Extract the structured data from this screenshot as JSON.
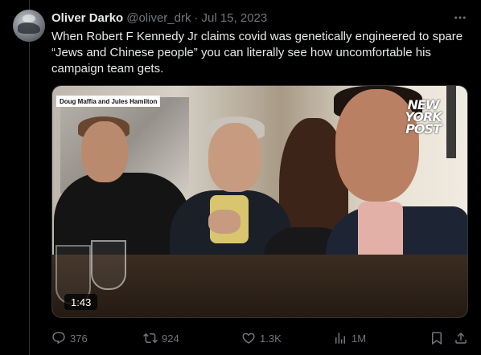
{
  "author": {
    "name": "Oliver Darko",
    "handle": "@oliver_drk",
    "separator": "·",
    "date": "Jul 15, 2023"
  },
  "tweet_text": "When Robert F Kennedy Jr claims covid was genetically engineered to spare “Jews and Chinese people” you can literally see how uncomfortable his campaign team gets.",
  "media": {
    "caption": "Doug Maffia and Jules Hamilton",
    "watermark_lines": [
      "NEW",
      "YORK",
      "POST"
    ],
    "duration": "1:43"
  },
  "actions": {
    "replies": "376",
    "reposts": "924",
    "likes": "1.3K",
    "views": "1M"
  },
  "icons": [
    "more-icon",
    "reply-icon",
    "repost-icon",
    "like-icon",
    "views-icon",
    "bookmark-icon",
    "share-icon"
  ],
  "colors": {
    "background": "#000000",
    "text": "#e7e9ea",
    "muted": "#71767b",
    "border": "#2f3336"
  }
}
